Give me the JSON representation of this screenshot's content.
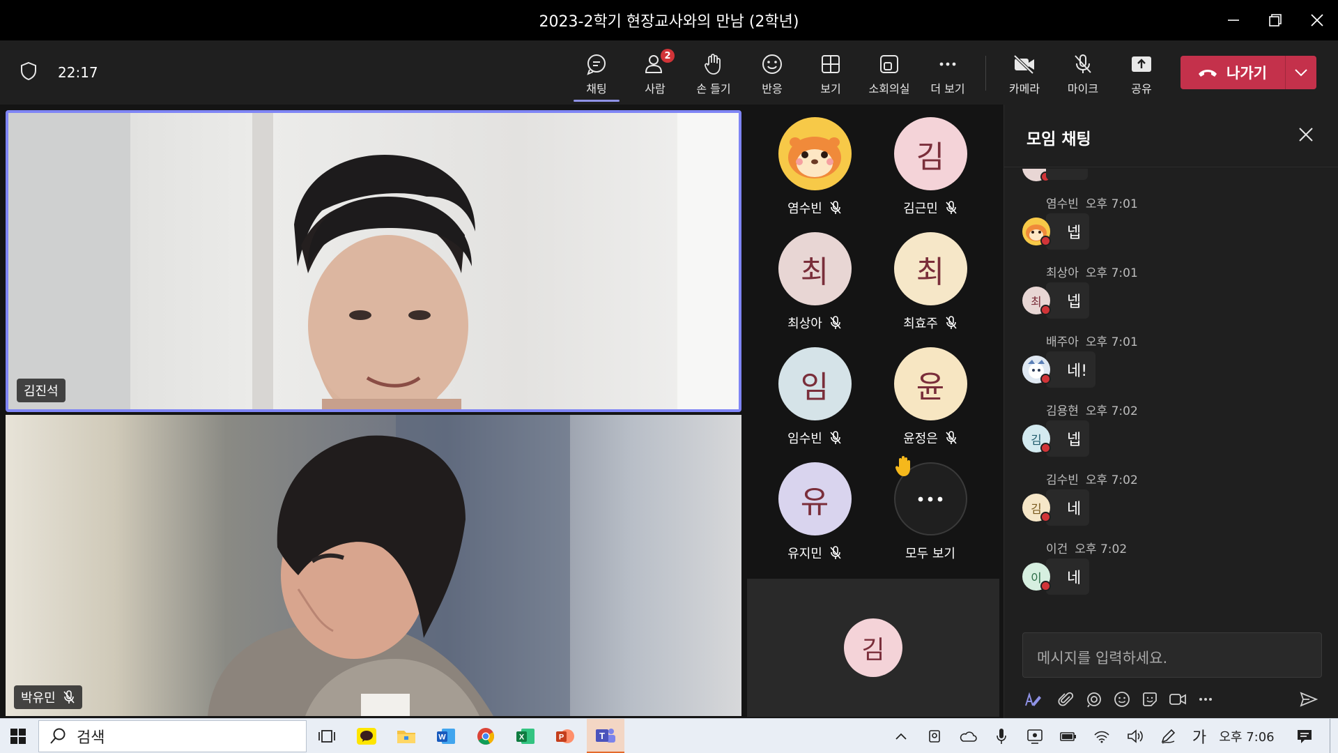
{
  "window": {
    "title": "2023-2학기 현장교사와의 만남 (2학년)"
  },
  "toolbar": {
    "time": "22:17",
    "buttons": [
      {
        "label": "채팅",
        "icon": "chat-icon"
      },
      {
        "label": "사람",
        "icon": "people-icon",
        "badge": "2"
      },
      {
        "label": "손 들기",
        "icon": "raise-hand-icon"
      },
      {
        "label": "반응",
        "icon": "reaction-icon"
      },
      {
        "label": "보기",
        "icon": "view-icon"
      },
      {
        "label": "소회의실",
        "icon": "breakout-room-icon"
      },
      {
        "label": "더 보기",
        "icon": "more-icon"
      },
      {
        "label": "카메라",
        "icon": "camera-off-icon"
      },
      {
        "label": "마이크",
        "icon": "mic-off-icon"
      },
      {
        "label": "공유",
        "icon": "share-icon"
      }
    ],
    "leave_label": "나가기",
    "colors": {
      "accent": "#7f85f5",
      "leave": "#c4314b"
    }
  },
  "stage": {
    "top_tile_name": "김진석",
    "bottom_tile_name": "박유민",
    "participants": [
      {
        "name": "염수빈",
        "initial": "",
        "avatar": "hamster-avatar",
        "bg": "#f7c948"
      },
      {
        "name": "김근민",
        "initial": "김",
        "bg": "#f4d3d8"
      },
      {
        "name": "최상아",
        "initial": "최",
        "bg": "#e8d6d4"
      },
      {
        "name": "최효주",
        "initial": "최",
        "bg": "#f6e7c8"
      },
      {
        "name": "임수빈",
        "initial": "임",
        "bg": "#d5e3e8"
      },
      {
        "name": "윤정은",
        "initial": "윤",
        "bg": "#f7e6c2"
      },
      {
        "name": "유지민",
        "initial": "유",
        "bg": "#d9d4ee"
      }
    ],
    "see_all_label": "모두 보기",
    "overflow_initial": "김"
  },
  "chat": {
    "title": "모임 채팅",
    "messages": [
      {
        "author": "염수빈",
        "time": "오후 7:01",
        "text": "넵",
        "initial": "",
        "avatar_bg": "#f7c948"
      },
      {
        "author": "최상아",
        "time": "오후 7:01",
        "text": "넵",
        "initial": "최",
        "avatar_bg": "#e8d6d4"
      },
      {
        "author": "배주아",
        "time": "오후 7:01",
        "text": "네!",
        "initial": "",
        "avatar_bg": "#dfe8f2"
      },
      {
        "author": "김용현",
        "time": "오후 7:02",
        "text": "넵",
        "initial": "김",
        "avatar_bg": "#d3eaf0"
      },
      {
        "author": "김수빈",
        "time": "오후 7:02",
        "text": "네",
        "initial": "김",
        "avatar_bg": "#f6e7c8"
      },
      {
        "author": "이건",
        "time": "오후 7:02",
        "text": "네",
        "initial": "이",
        "avatar_bg": "#d6efe0"
      }
    ],
    "compose_placeholder": "메시지를 입력하세요."
  },
  "taskbar": {
    "search_label": "검색",
    "ime": "가",
    "clock": "오후 7:06"
  }
}
